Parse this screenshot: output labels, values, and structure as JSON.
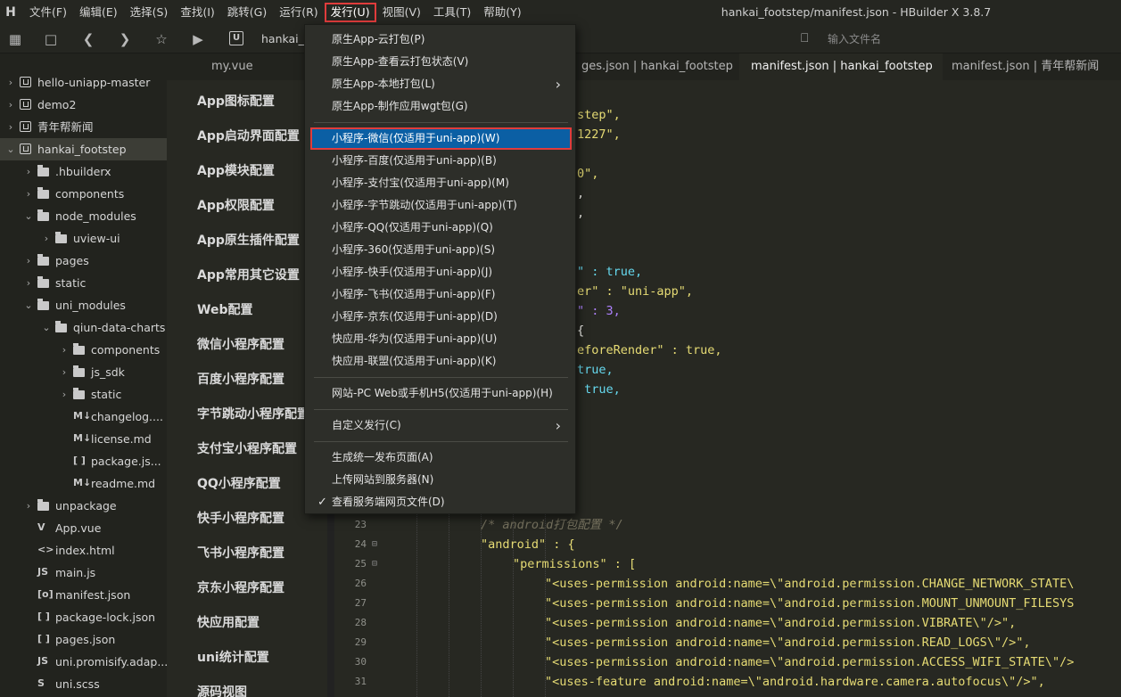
{
  "app": {
    "logo": "H",
    "window_title": "hankai_footstep/manifest.json - HBuilder X 3.8.7"
  },
  "menubar": [
    "文件(F)",
    "编辑(E)",
    "选择(S)",
    "查找(I)",
    "跳转(G)",
    "运行(R)",
    "发行(U)",
    "视图(V)",
    "工具(T)",
    "帮助(Y)"
  ],
  "toolbar": {
    "breadcrumb_icon": "U",
    "breadcrumb": "hankai_fo",
    "file_search_placeholder": "输入文件名"
  },
  "sidebar": [
    {
      "label": "hello-uniapp-master",
      "type": "project",
      "depth": 0,
      "expanded": false
    },
    {
      "label": "demo2",
      "type": "project",
      "depth": 0,
      "expanded": false
    },
    {
      "label": "青年帮新闻",
      "type": "project",
      "depth": 0,
      "expanded": false
    },
    {
      "label": "hankai_footstep",
      "type": "project",
      "depth": 0,
      "expanded": true,
      "selected": true
    },
    {
      "label": ".hbuilderx",
      "type": "folder",
      "depth": 1,
      "expanded": false
    },
    {
      "label": "components",
      "type": "folder",
      "depth": 1,
      "expanded": false
    },
    {
      "label": "node_modules",
      "type": "folder",
      "depth": 1,
      "expanded": true
    },
    {
      "label": "uview-ui",
      "type": "folder",
      "depth": 2,
      "expanded": false
    },
    {
      "label": "pages",
      "type": "folder",
      "depth": 1,
      "expanded": false
    },
    {
      "label": "static",
      "type": "folder",
      "depth": 1,
      "expanded": false
    },
    {
      "label": "uni_modules",
      "type": "folder",
      "depth": 1,
      "expanded": true
    },
    {
      "label": "qiun-data-charts",
      "type": "folder",
      "depth": 2,
      "expanded": true
    },
    {
      "label": "components",
      "type": "folder",
      "depth": 3,
      "expanded": false
    },
    {
      "label": "js_sdk",
      "type": "folder",
      "depth": 3,
      "expanded": false
    },
    {
      "label": "static",
      "type": "folder",
      "depth": 3,
      "expanded": false
    },
    {
      "label": "changelog....",
      "type": "file",
      "icon": "M↓",
      "depth": 3
    },
    {
      "label": "license.md",
      "type": "file",
      "icon": "M↓",
      "depth": 3
    },
    {
      "label": "package.js...",
      "type": "file",
      "icon": "[ ]",
      "depth": 3
    },
    {
      "label": "readme.md",
      "type": "file",
      "icon": "M↓",
      "depth": 3
    },
    {
      "label": "unpackage",
      "type": "folder",
      "depth": 1,
      "expanded": false
    },
    {
      "label": "App.vue",
      "type": "file",
      "icon": "V",
      "depth": 1
    },
    {
      "label": "index.html",
      "type": "file",
      "icon": "<>",
      "depth": 1
    },
    {
      "label": "main.js",
      "type": "file",
      "icon": "JS",
      "depth": 1
    },
    {
      "label": "manifest.json",
      "type": "file",
      "icon": "[o]",
      "depth": 1
    },
    {
      "label": "package-lock.json",
      "type": "file",
      "icon": "[ ]",
      "depth": 1
    },
    {
      "label": "pages.json",
      "type": "file",
      "icon": "[ ]",
      "depth": 1
    },
    {
      "label": "uni.promisify.adap...",
      "type": "file",
      "icon": "JS",
      "depth": 1
    },
    {
      "label": "uni.scss",
      "type": "file",
      "icon": "S",
      "depth": 1
    }
  ],
  "tabs": [
    {
      "label": "my.vue",
      "active": false
    },
    {
      "label": "ges.json | hankai_footstep",
      "active": false
    },
    {
      "label": "manifest.json | hankai_footstep",
      "active": true
    },
    {
      "label": "manifest.json | 青年帮新闻",
      "active": false
    }
  ],
  "config_nav": [
    "App图标配置",
    "App启动界面配置",
    "App模块配置",
    "App权限配置",
    "App原生插件配置",
    "App常用其它设置",
    "Web配置",
    "微信小程序配置",
    "百度小程序配置",
    "字节跳动小程序配置",
    "支付宝小程序配置",
    "QQ小程序配置",
    "快手小程序配置",
    "飞书小程序配置",
    "京东小程序配置",
    "快应用配置",
    "uni统计配置",
    "源码视图"
  ],
  "code_fragments": [
    {
      "text": "step\",",
      "cls": "s"
    },
    {
      "text": "1227\",",
      "cls": "s"
    },
    {
      "text": "",
      "cls": "s"
    },
    {
      "text": "0\",",
      "cls": "s"
    },
    {
      "text": ",",
      "cls": "p"
    },
    {
      "text": ",",
      "cls": "p"
    },
    {
      "text": "",
      "cls": "p"
    },
    {
      "text": "",
      "cls": "p"
    },
    {
      "text": "\" : true,",
      "cls": "mix1"
    },
    {
      "text": "er\" : \"uni-app\",",
      "cls": "mix2"
    },
    {
      "text": "\" : 3,",
      "cls": "mix3"
    },
    {
      "text": "{",
      "cls": "p"
    },
    {
      "text": "eforeRender\" : true,",
      "cls": "mix4"
    },
    {
      "text": "true,",
      "cls": "k"
    },
    {
      "text": " true,",
      "cls": "k"
    }
  ],
  "code_lines": [
    {
      "n": "23",
      "fold": "",
      "text": "/* android打包配置 */",
      "kind": "comment",
      "indent": 4
    },
    {
      "n": "24",
      "fold": "⊟",
      "text": "\"android\" : {",
      "kind": "key",
      "indent": 4
    },
    {
      "n": "25",
      "fold": "⊟",
      "text": "\"permissions\" : [",
      "kind": "key",
      "indent": 5
    },
    {
      "n": "26",
      "fold": "",
      "text": "\"<uses-permission android:name=\\\"android.permission.CHANGE_NETWORK_STATE\\",
      "kind": "str",
      "indent": 6
    },
    {
      "n": "27",
      "fold": "",
      "text": "\"<uses-permission android:name=\\\"android.permission.MOUNT_UNMOUNT_FILESYS",
      "kind": "str",
      "indent": 6
    },
    {
      "n": "28",
      "fold": "",
      "text": "\"<uses-permission android:name=\\\"android.permission.VIBRATE\\\"/>\",",
      "kind": "str",
      "indent": 6
    },
    {
      "n": "29",
      "fold": "",
      "text": "\"<uses-permission android:name=\\\"android.permission.READ_LOGS\\\"/>\",",
      "kind": "str",
      "indent": 6
    },
    {
      "n": "30",
      "fold": "",
      "text": "\"<uses-permission android:name=\\\"android.permission.ACCESS_WIFI_STATE\\\"/>",
      "kind": "str",
      "indent": 6
    },
    {
      "n": "31",
      "fold": "",
      "text": "\"<uses-feature android:name=\\\"android.hardware.camera.autofocus\\\"/>\",",
      "kind": "str",
      "indent": 6
    }
  ],
  "dropdown": {
    "groups": [
      [
        {
          "label": "原生App-云打包(P)"
        },
        {
          "label": "原生App-查看云打包状态(V)"
        },
        {
          "label": "原生App-本地打包(L)",
          "submenu": true
        },
        {
          "label": "原生App-制作应用wgt包(G)"
        }
      ],
      [
        {
          "label": "小程序-微信(仅适用于uni-app)(W)",
          "highlight": true
        },
        {
          "label": "小程序-百度(仅适用于uni-app)(B)"
        },
        {
          "label": "小程序-支付宝(仅适用于uni-app)(M)"
        },
        {
          "label": "小程序-字节跳动(仅适用于uni-app)(T)"
        },
        {
          "label": "小程序-QQ(仅适用于uni-app)(Q)"
        },
        {
          "label": "小程序-360(仅适用于uni-app)(S)"
        },
        {
          "label": "小程序-快手(仅适用于uni-app)(J)"
        },
        {
          "label": "小程序-飞书(仅适用于uni-app)(F)"
        },
        {
          "label": "小程序-京东(仅适用于uni-app)(D)"
        },
        {
          "label": "快应用-华为(仅适用于uni-app)(U)"
        },
        {
          "label": "快应用-联盟(仅适用于uni-app)(K)"
        }
      ],
      [
        {
          "label": "网站-PC Web或手机H5(仅适用于uni-app)(H)"
        }
      ],
      [
        {
          "label": "自定义发行(C)",
          "submenu": true
        }
      ],
      [
        {
          "label": "生成统一发布页面(A)"
        },
        {
          "label": "上传网站到服务器(N)"
        },
        {
          "label": "查看服务端网页文件(D)",
          "checked": true
        }
      ]
    ]
  },
  "colors": {
    "accent_highlight": "#0b5fa4",
    "annotation_red": "#e03c3c",
    "string": "#e6db74",
    "keyword": "#66d9ef",
    "comment": "#75715e"
  }
}
